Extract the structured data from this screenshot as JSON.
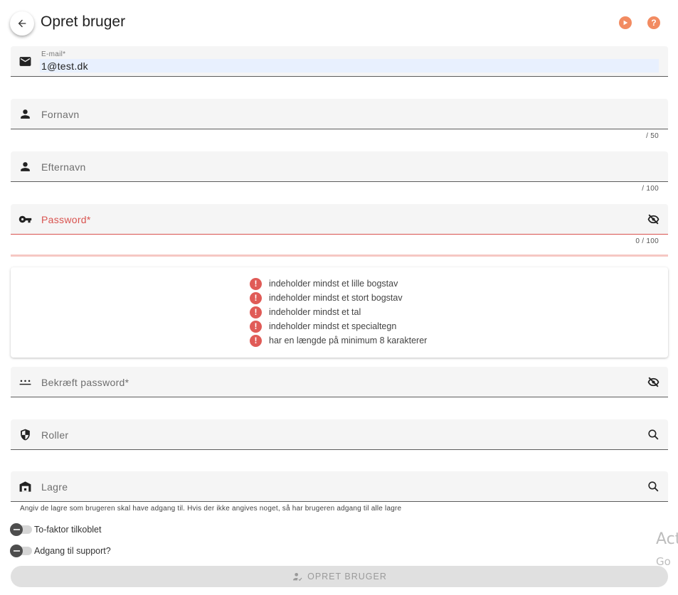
{
  "header": {
    "title": "Opret bruger",
    "accent_color": "#f28b61"
  },
  "form": {
    "email": {
      "label": "E-mail*",
      "value": "1@test.dk",
      "icon": "mail-icon"
    },
    "first_name": {
      "placeholder": "Fornavn",
      "counter": "/ 50",
      "icon": "person-icon"
    },
    "last_name": {
      "placeholder": "Efternavn",
      "counter": "/ 100",
      "icon": "person-icon"
    },
    "password": {
      "placeholder": "Password*",
      "counter": "0 / 100",
      "icon": "key-icon",
      "error_color": "#d9534f"
    },
    "password_requirements": [
      "indeholder mindst et lille bogstav",
      "indeholder mindst et stort bogstav",
      "indeholder mindst et tal",
      "indeholder mindst et specialtegn",
      "har en længde på minimum 8 karakterer"
    ],
    "confirm_password": {
      "placeholder": "Bekræft password*",
      "icon": "password-dots-icon"
    },
    "roles": {
      "placeholder": "Roller",
      "icon": "shield-icon"
    },
    "warehouses": {
      "placeholder": "Lagre",
      "icon": "warehouse-icon",
      "hint": "Angiv de lagre som brugeren skal have adgang til. Hvis der ikke angives noget, så har brugeren adgang til alle lagre"
    },
    "two_factor": {
      "label": "To-faktor tilkoblet",
      "checked": false
    },
    "support_access": {
      "label": "Adgang til support?",
      "checked": false
    },
    "submit_label": "OPRET BRUGER"
  },
  "watermark": {
    "line1": "Act",
    "line2": "Go"
  }
}
